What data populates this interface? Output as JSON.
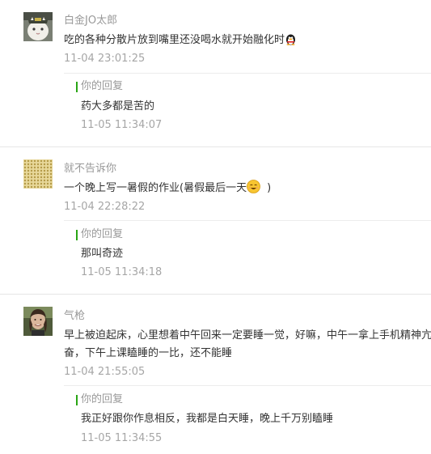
{
  "comments": [
    {
      "username": "白金JO太郎",
      "content": "吃的各种分散片放到嘴里还没喝水就开始融化时",
      "emoji": "qq-penguin-icon",
      "time": "11-04 23:01:25",
      "reply": {
        "label": "你的回复",
        "text": "药大多都是苦的",
        "time": "11-05 11:34:07"
      }
    },
    {
      "username": "就不告诉你",
      "content": "一个晚上写一暑假的作业(暑假最后一天",
      "content_suffix": ")",
      "emoji": "smiley-icon",
      "time": "11-04 22:28:22",
      "reply": {
        "label": "你的回复",
        "text": "那叫奇迹",
        "time": "11-05 11:34:18"
      }
    },
    {
      "username": "气枪",
      "content_line1": "早上被迫起床，心里想着中午回来一定要睡一觉，好嘛，中午一拿上手机精神亢",
      "content_line2": "奋，下午上课瞌睡的一比，还不能睡",
      "time": "11-04 21:55:05",
      "reply": {
        "label": "你的回复",
        "text": "我正好跟你作息相反，我都是白天睡，晚上千万别瞌睡",
        "time": "11-05 11:34:55"
      }
    }
  ],
  "colors": {
    "reply_accent": "#2aa515",
    "meta_text": "#999999",
    "body_text": "#333333"
  }
}
